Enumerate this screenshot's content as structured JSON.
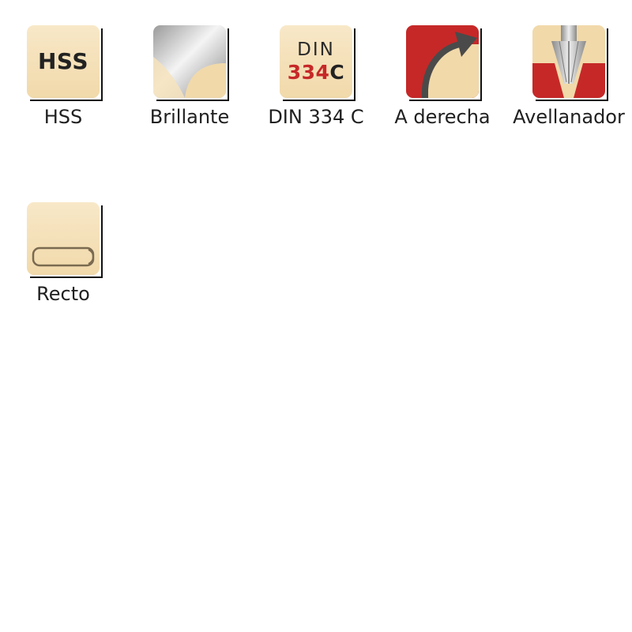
{
  "features": [
    {
      "label": "HSS",
      "icon": "hss-icon",
      "icon_text": "HSS"
    },
    {
      "label": "Brillante",
      "icon": "bright-finish-icon"
    },
    {
      "label": "DIN 334 C",
      "icon": "din-standard-icon",
      "icon_text_line1": "DIN",
      "icon_text_number": "334",
      "icon_text_letter": "C"
    },
    {
      "label": "A derecha",
      "icon": "right-hand-rotation-icon"
    },
    {
      "label": "Avellanador",
      "icon": "countersink-icon"
    },
    {
      "label": "Recto",
      "icon": "straight-shank-icon"
    }
  ],
  "colors": {
    "tile_background": "#f3deb3",
    "accent_red": "#c62828",
    "text": "#202020"
  }
}
